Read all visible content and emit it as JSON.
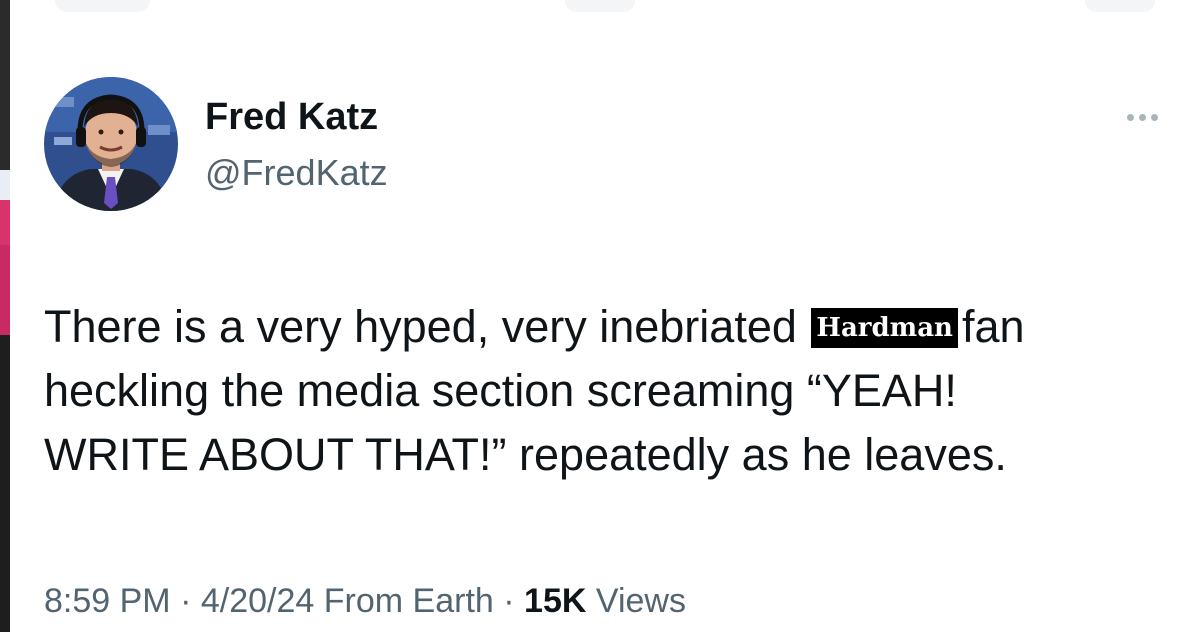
{
  "author": {
    "display_name": "Fred Katz",
    "handle": "@FredKatz",
    "avatar_icon": "person-avatar-icon"
  },
  "more_icon": "more-horizontal-icon",
  "tweet": {
    "line1_before": "There is a very hyped, very inebriated",
    "redacted_label": "Hardman",
    "line1_after": "fan",
    "line2": "heckling the media section screaming “YEAH!",
    "line3": "WRITE ABOUT THAT!” repeatedly as he leaves."
  },
  "meta": {
    "time": "8:59 PM",
    "sep1": "·",
    "date": "4/20/24",
    "source": "From Earth",
    "sep2": "·",
    "views_count": "15K",
    "views_label": "Views"
  },
  "colors": {
    "text_primary": "#0f1419",
    "text_secondary": "#536471",
    "redaction_bg": "#000000"
  }
}
